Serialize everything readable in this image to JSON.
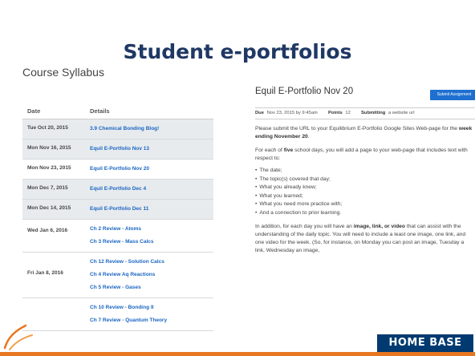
{
  "slide": {
    "title": "Student e-portfolios",
    "logo_text": "HOME BASE",
    "colors": {
      "title": "#1f3864",
      "accent": "#e87722",
      "link": "#1a66c2",
      "button": "#1e6fd0",
      "logo_bg": "#003a70"
    }
  },
  "syllabus": {
    "heading": "Course Syllabus",
    "columns": [
      "Date",
      "Details"
    ],
    "rows": [
      {
        "date": "Tue Oct 20, 2015",
        "details": [
          "3.9 Chemical Bonding Blog!"
        ]
      },
      {
        "date": "Mon Nov 16, 2015",
        "details": [
          "Equil E-Portfolio Nov 13"
        ]
      },
      {
        "date": "Mon Nov 23, 2015",
        "details": [
          "Equil E-Portfolio Nov 20"
        ]
      },
      {
        "date": "Mon Dec 7, 2015",
        "details": [
          "Equil E-Portfolio Dec 4"
        ]
      },
      {
        "date": "Mon Dec 14, 2015",
        "details": [
          "Equil E-Portfolio Dec 11"
        ]
      },
      {
        "date": "Wed Jan 6, 2016",
        "details": [
          "Ch 2 Review - Atoms",
          "Ch 3 Review - Mass Calcs"
        ]
      },
      {
        "date": "Fri Jan 8, 2016",
        "details": [
          "Ch 12 Review - Solution Calcs",
          "Ch 4 Review Aq Reactions",
          "Ch 5 Review - Gases"
        ]
      },
      {
        "date": "",
        "details": [
          "Ch 10 Review - Bonding II",
          "Ch 7 Review - Quantum Theory"
        ]
      }
    ]
  },
  "assignment": {
    "title": "Equil E-Portfolio Nov 20",
    "submit_label": "Submit Assignment",
    "due_label": "Due",
    "due_value": "Nov 23, 2015 by 9:45am",
    "points_label": "Points",
    "points_value": "12",
    "submitting_label": "Submitting",
    "submitting_value": "a website url",
    "p1_before": "Please submit the URL to your Equilibrium E-Portfolio Google Sites Web-page for the ",
    "p1_bold": "week ending November 20",
    "p1_after": ".",
    "p2_before": "For each of ",
    "p2_bold": "five",
    "p2_after": " school days, you will add a page to your web-page that includes text with respect to:",
    "bullets": [
      "The date;",
      "The topic(s) covered that day;",
      "What you already knew;",
      "What you learned;",
      "What you need more practice with;",
      "And a connection to prior learning."
    ],
    "p3_before": "In addition, for each day you will have an ",
    "p3_bold": "image, link, or video",
    "p3_after": " that can assist with the understanding of the daily topic.  You will need to include a least one image, one link, and one video for the week.  (So, for instance, on Monday you can post an image, Tuesday a link, Wednesday an image,"
  }
}
